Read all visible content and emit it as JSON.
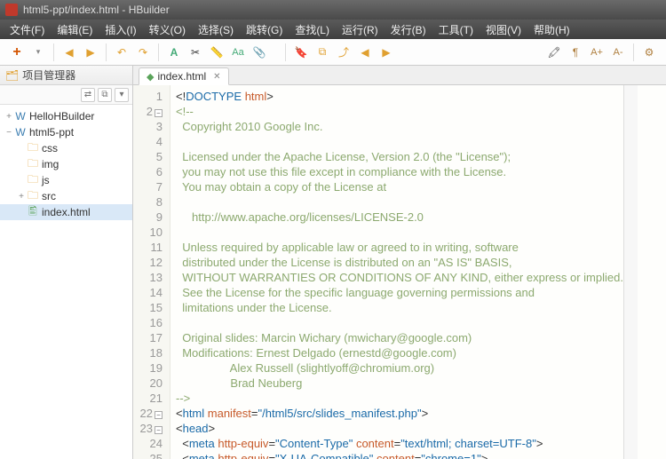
{
  "window": {
    "title": "html5-ppt/index.html  -  HBuilder"
  },
  "menu": {
    "file": "文件(F)",
    "edit": "编辑(E)",
    "insert": "插入(I)",
    "goto": "转义(O)",
    "select": "选择(S)",
    "jump": "跳转(G)",
    "find": "查找(L)",
    "run": "运行(R)",
    "publish": "发行(B)",
    "tools": "工具(T)",
    "view": "视图(V)",
    "help": "帮助(H)"
  },
  "toolbar": {
    "new": "+",
    "open": "▾",
    "back": "◀",
    "forward": "▶",
    "undo": "↶",
    "redo": "↷",
    "style": "A",
    "cut": "✂",
    "ruler": "📏",
    "case": "Aa",
    "clip": "📎",
    "bookmark": "🔖",
    "bm2": "⧉",
    "bm3": "⤴",
    "prev": "◀",
    "next": "▶",
    "marker": "🖍",
    "para": "¶",
    "inc": "A+",
    "dec": "A-",
    "cfg": "⚙"
  },
  "sidebar": {
    "title": "项目管理器",
    "toolIcons": [
      "⇄",
      "⧉",
      "▾"
    ],
    "tree": [
      {
        "type": "proj",
        "label": "HelloHBuilder",
        "indent": 0,
        "twist": "+"
      },
      {
        "type": "proj",
        "label": "html5-ppt",
        "indent": 0,
        "twist": "−"
      },
      {
        "type": "folder",
        "label": "css",
        "indent": 1,
        "twist": ""
      },
      {
        "type": "folder",
        "label": "img",
        "indent": 1,
        "twist": ""
      },
      {
        "type": "folder",
        "label": "js",
        "indent": 1,
        "twist": ""
      },
      {
        "type": "folder",
        "label": "src",
        "indent": 1,
        "twist": "+"
      },
      {
        "type": "file",
        "label": "index.html",
        "indent": 1,
        "twist": "",
        "sel": true
      }
    ]
  },
  "tabs": {
    "active": "index.html"
  },
  "code": {
    "lines": [
      {
        "n": 1,
        "fold": "",
        "seg": [
          [
            "punc",
            "<!"
          ],
          [
            "tag",
            "DOCTYPE "
          ],
          [
            "attr",
            "html"
          ],
          [
            "punc",
            ">"
          ]
        ]
      },
      {
        "n": 2,
        "fold": "-",
        "seg": [
          [
            "comment",
            "<!--"
          ]
        ]
      },
      {
        "n": 3,
        "fold": "",
        "seg": [
          [
            "comment",
            "  Copyright 2010 Google Inc."
          ]
        ]
      },
      {
        "n": 4,
        "fold": "",
        "seg": [
          [
            "comment",
            " "
          ]
        ]
      },
      {
        "n": 5,
        "fold": "",
        "seg": [
          [
            "comment",
            "  Licensed under the Apache License, Version 2.0 (the \"License\");"
          ]
        ]
      },
      {
        "n": 6,
        "fold": "",
        "seg": [
          [
            "comment",
            "  you may not use this file except in compliance with the License."
          ]
        ]
      },
      {
        "n": 7,
        "fold": "",
        "seg": [
          [
            "comment",
            "  You may obtain a copy of the License at"
          ]
        ]
      },
      {
        "n": 8,
        "fold": "",
        "seg": [
          [
            "comment",
            " "
          ]
        ]
      },
      {
        "n": 9,
        "fold": "",
        "seg": [
          [
            "comment",
            "     http://www.apache.org/licenses/LICENSE-2.0"
          ]
        ]
      },
      {
        "n": 10,
        "fold": "",
        "seg": [
          [
            "comment",
            " "
          ]
        ]
      },
      {
        "n": 11,
        "fold": "",
        "seg": [
          [
            "comment",
            "  Unless required by applicable law or agreed to in writing, software"
          ]
        ]
      },
      {
        "n": 12,
        "fold": "",
        "seg": [
          [
            "comment",
            "  distributed under the License is distributed on an \"AS IS\" BASIS,"
          ]
        ]
      },
      {
        "n": 13,
        "fold": "",
        "seg": [
          [
            "comment",
            "  WITHOUT WARRANTIES OR CONDITIONS OF ANY KIND, either express or implied."
          ]
        ]
      },
      {
        "n": 14,
        "fold": "",
        "seg": [
          [
            "comment",
            "  See the License for the specific language governing permissions and"
          ]
        ]
      },
      {
        "n": 15,
        "fold": "",
        "seg": [
          [
            "comment",
            "  limitations under the License."
          ]
        ]
      },
      {
        "n": 16,
        "fold": "",
        "seg": [
          [
            "comment",
            " "
          ]
        ]
      },
      {
        "n": 17,
        "fold": "",
        "seg": [
          [
            "comment",
            "  Original slides: Marcin Wichary (mwichary@google.com)"
          ]
        ]
      },
      {
        "n": 18,
        "fold": "",
        "seg": [
          [
            "comment",
            "  Modifications: Ernest Delgado (ernestd@google.com)"
          ]
        ]
      },
      {
        "n": 19,
        "fold": "",
        "seg": [
          [
            "comment",
            "                 Alex Russell (slightlyoff@chromium.org)"
          ]
        ]
      },
      {
        "n": 20,
        "fold": "",
        "seg": [
          [
            "comment",
            "                 Brad Neuberg"
          ]
        ]
      },
      {
        "n": 21,
        "fold": "",
        "seg": [
          [
            "comment",
            "-->"
          ]
        ]
      },
      {
        "n": 22,
        "fold": "-",
        "seg": [
          [
            "punc",
            "<"
          ],
          [
            "tag",
            "html "
          ],
          [
            "attr",
            "manifest"
          ],
          [
            "punc",
            "="
          ],
          [
            "str",
            "\"/html5/src/slides_manifest.php\""
          ],
          [
            "punc",
            ">"
          ]
        ]
      },
      {
        "n": 23,
        "fold": "-",
        "seg": [
          [
            "punc",
            "<"
          ],
          [
            "tag",
            "head"
          ],
          [
            "punc",
            ">"
          ]
        ]
      },
      {
        "n": 24,
        "fold": "",
        "seg": [
          [
            "punc",
            "  <"
          ],
          [
            "tag",
            "meta "
          ],
          [
            "attr",
            "http-equiv"
          ],
          [
            "punc",
            "="
          ],
          [
            "str",
            "\"Content-Type\""
          ],
          [
            "punc",
            " "
          ],
          [
            "attr",
            "content"
          ],
          [
            "punc",
            "="
          ],
          [
            "str",
            "\"text/html; charset=UTF-8\""
          ],
          [
            "punc",
            ">"
          ]
        ]
      },
      {
        "n": 25,
        "fold": "",
        "seg": [
          [
            "punc",
            "  <"
          ],
          [
            "tag",
            "meta "
          ],
          [
            "attr",
            "http-equiv"
          ],
          [
            "punc",
            "="
          ],
          [
            "str",
            "\"X-UA-Compatible\""
          ],
          [
            "punc",
            " "
          ],
          [
            "attr",
            "content"
          ],
          [
            "punc",
            "="
          ],
          [
            "str",
            "\"chrome=1\""
          ],
          [
            "punc",
            ">"
          ]
        ]
      }
    ]
  }
}
